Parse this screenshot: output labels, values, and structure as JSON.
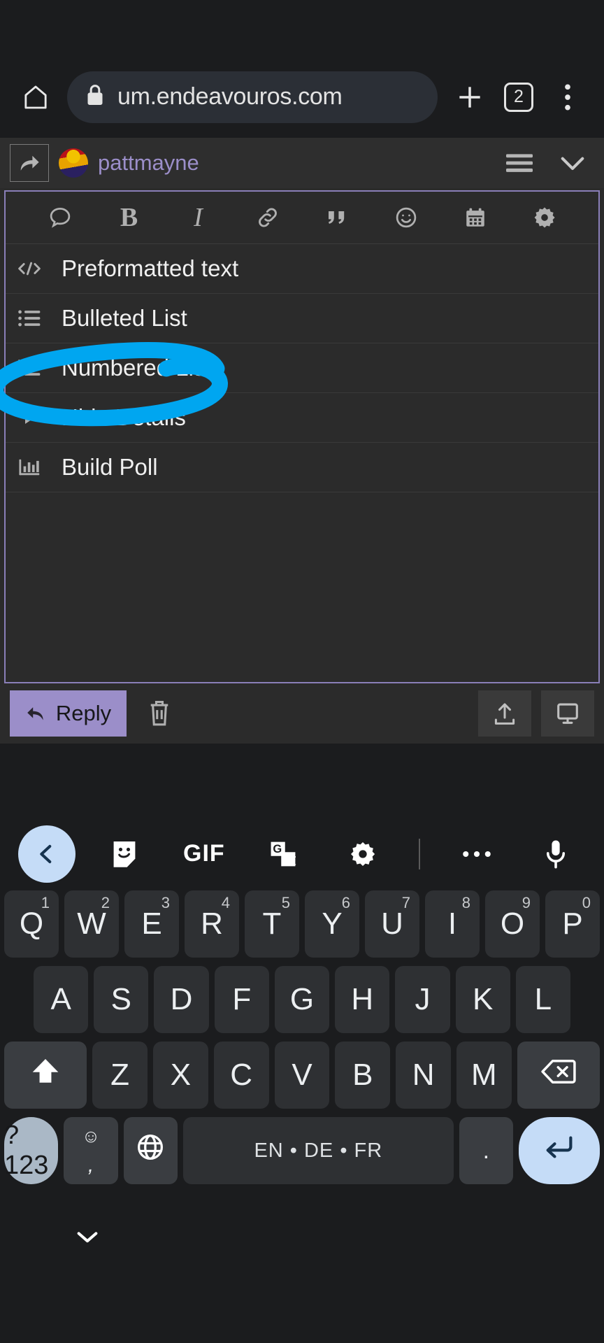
{
  "browser": {
    "home_icon": "home-icon",
    "lock_icon": "lock-icon",
    "url": "um.endeavouros.com",
    "new_tab_label": "+",
    "tab_count": "2",
    "menu_icon": "overflow-menu-icon"
  },
  "post_header": {
    "reply_icon": "reply-arrow-icon",
    "username": "pattmayne",
    "hamburger_icon": "hamburger-icon",
    "chevron_icon": "chevron-down-icon"
  },
  "composer": {
    "toolbar": [
      {
        "name": "speech-bubble-icon",
        "label": ""
      },
      {
        "name": "bold-icon",
        "label": "B"
      },
      {
        "name": "italic-icon",
        "label": "I"
      },
      {
        "name": "link-icon",
        "label": ""
      },
      {
        "name": "quote-icon",
        "label": ""
      },
      {
        "name": "emoji-icon",
        "label": ""
      },
      {
        "name": "calendar-icon",
        "label": ""
      },
      {
        "name": "gear-icon",
        "label": ""
      }
    ],
    "menu_items": [
      {
        "icon": "code-icon",
        "label": "Preformatted text",
        "highlighted": true
      },
      {
        "icon": "bulleted-list-icon",
        "label": "Bulleted List",
        "highlighted": false
      },
      {
        "icon": "numbered-list-icon",
        "label": "Numbered List",
        "highlighted": false
      },
      {
        "icon": "triangle-right-icon",
        "label": "Hide Details",
        "highlighted": false
      },
      {
        "icon": "poll-chart-icon",
        "label": "Build Poll",
        "highlighted": false
      }
    ]
  },
  "actions": {
    "reply_label": "Reply",
    "reply_icon": "reply-arrow-icon",
    "delete_icon": "trash-icon",
    "upload_icon": "upload-icon",
    "preview_icon": "monitor-icon"
  },
  "keyboard": {
    "toolbar": [
      "chevron-left-icon",
      "sticker-icon",
      "gif-icon",
      "translate-icon",
      "gear-icon",
      "more-dots-icon",
      "microphone-icon"
    ],
    "gif_label": "GIF",
    "row1": [
      {
        "key": "Q",
        "sup": "1"
      },
      {
        "key": "W",
        "sup": "2"
      },
      {
        "key": "E",
        "sup": "3"
      },
      {
        "key": "R",
        "sup": "4"
      },
      {
        "key": "T",
        "sup": "5"
      },
      {
        "key": "Y",
        "sup": "6"
      },
      {
        "key": "U",
        "sup": "7"
      },
      {
        "key": "I",
        "sup": "8"
      },
      {
        "key": "O",
        "sup": "9"
      },
      {
        "key": "P",
        "sup": "0"
      }
    ],
    "row2": [
      "A",
      "S",
      "D",
      "F",
      "G",
      "H",
      "J",
      "K",
      "L"
    ],
    "row3": [
      "Z",
      "X",
      "C",
      "V",
      "B",
      "N",
      "M"
    ],
    "shift_icon": "shift-up-arrow-icon",
    "backspace_icon": "backspace-icon",
    "symbols_label": "?123",
    "emoji_comma": {
      "emoji": "☺",
      "comma": ","
    },
    "globe_icon": "globe-icon",
    "space_label": "EN • DE • FR",
    "period_label": ".",
    "enter_icon": "enter-return-icon",
    "hide_keyboard_icon": "chevron-down-icon"
  },
  "annotation": {
    "type": "hand-drawn-circle",
    "color": "#00A6F0",
    "targets": "Preformatted text"
  },
  "colors": {
    "page_bg": "#2b2b2b",
    "chrome_bg": "#1b1c1e",
    "accent_purple": "#9b8ec9",
    "keyboard_bg": "#1b1c1e",
    "key_bg": "#2e3033",
    "annotation_blue": "#00A6F0"
  }
}
